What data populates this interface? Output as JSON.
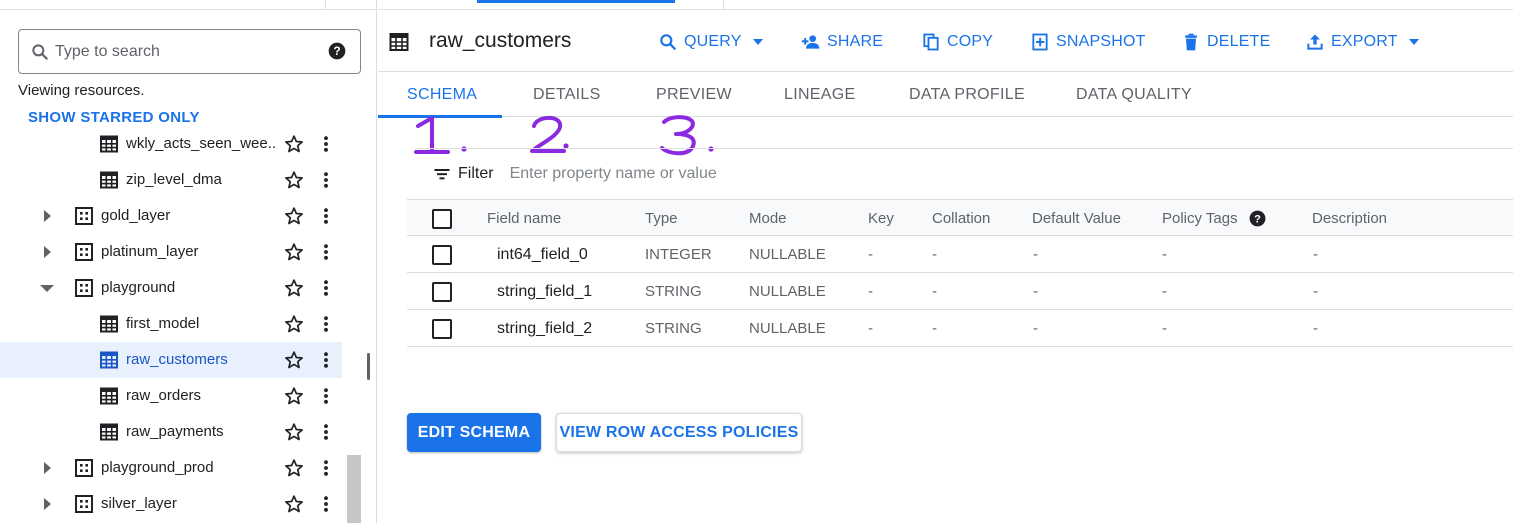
{
  "colors": {
    "accent": "#1a73e8",
    "selected_bg": "#e8f0fe",
    "annotation": "#8a2be2"
  },
  "explorer": {
    "search_placeholder": "Type to search",
    "viewing_text": "Viewing resources.",
    "show_starred_label": "SHOW STARRED ONLY",
    "tree": [
      {
        "label": "wkly_acts_seen_wee...",
        "type": "table",
        "depth": 2,
        "expanded": null,
        "selected": false
      },
      {
        "label": "zip_level_dma",
        "type": "table",
        "depth": 2,
        "expanded": null,
        "selected": false
      },
      {
        "label": "gold_layer",
        "type": "dataset",
        "depth": 1,
        "expanded": false,
        "selected": false
      },
      {
        "label": "platinum_layer",
        "type": "dataset",
        "depth": 1,
        "expanded": false,
        "selected": false
      },
      {
        "label": "playground",
        "type": "dataset",
        "depth": 1,
        "expanded": true,
        "selected": false
      },
      {
        "label": "first_model",
        "type": "table",
        "depth": 2,
        "expanded": null,
        "selected": false
      },
      {
        "label": "raw_customers",
        "type": "table",
        "depth": 2,
        "expanded": null,
        "selected": true
      },
      {
        "label": "raw_orders",
        "type": "table",
        "depth": 2,
        "expanded": null,
        "selected": false
      },
      {
        "label": "raw_payments",
        "type": "table",
        "depth": 2,
        "expanded": null,
        "selected": false
      },
      {
        "label": "playground_prod",
        "type": "dataset",
        "depth": 1,
        "expanded": false,
        "selected": false
      },
      {
        "label": "silver_layer",
        "type": "dataset",
        "depth": 1,
        "expanded": false,
        "selected": false
      }
    ]
  },
  "header": {
    "title": "raw_customers",
    "actions": {
      "query": "QUERY",
      "share": "SHARE",
      "copy": "COPY",
      "snapshot": "SNAPSHOT",
      "delete": "DELETE",
      "export": "EXPORT"
    }
  },
  "tabs": {
    "schema": "SCHEMA",
    "details": "DETAILS",
    "preview": "PREVIEW",
    "lineage": "LINEAGE",
    "data_profile": "DATA PROFILE",
    "data_quality": "DATA QUALITY",
    "active": "schema"
  },
  "annotations": [
    "1.",
    "2.",
    "3."
  ],
  "filter": {
    "label": "Filter",
    "placeholder": "Enter property name or value"
  },
  "schema_table": {
    "columns": {
      "field_name": "Field name",
      "type": "Type",
      "mode": "Mode",
      "key": "Key",
      "collation": "Collation",
      "default_value": "Default Value",
      "policy_tags": "Policy Tags",
      "description": "Description"
    },
    "rows": [
      {
        "field_name": "int64_field_0",
        "type": "INTEGER",
        "mode": "NULLABLE",
        "key": "-",
        "collation": "-",
        "default_value": "-",
        "policy_tags": "-",
        "description": "-"
      },
      {
        "field_name": "string_field_1",
        "type": "STRING",
        "mode": "NULLABLE",
        "key": "-",
        "collation": "-",
        "default_value": "-",
        "policy_tags": "-",
        "description": "-"
      },
      {
        "field_name": "string_field_2",
        "type": "STRING",
        "mode": "NULLABLE",
        "key": "-",
        "collation": "-",
        "default_value": "-",
        "policy_tags": "-",
        "description": "-"
      }
    ]
  },
  "buttons": {
    "edit_schema": "EDIT SCHEMA",
    "view_row_access": "VIEW ROW ACCESS POLICIES"
  }
}
